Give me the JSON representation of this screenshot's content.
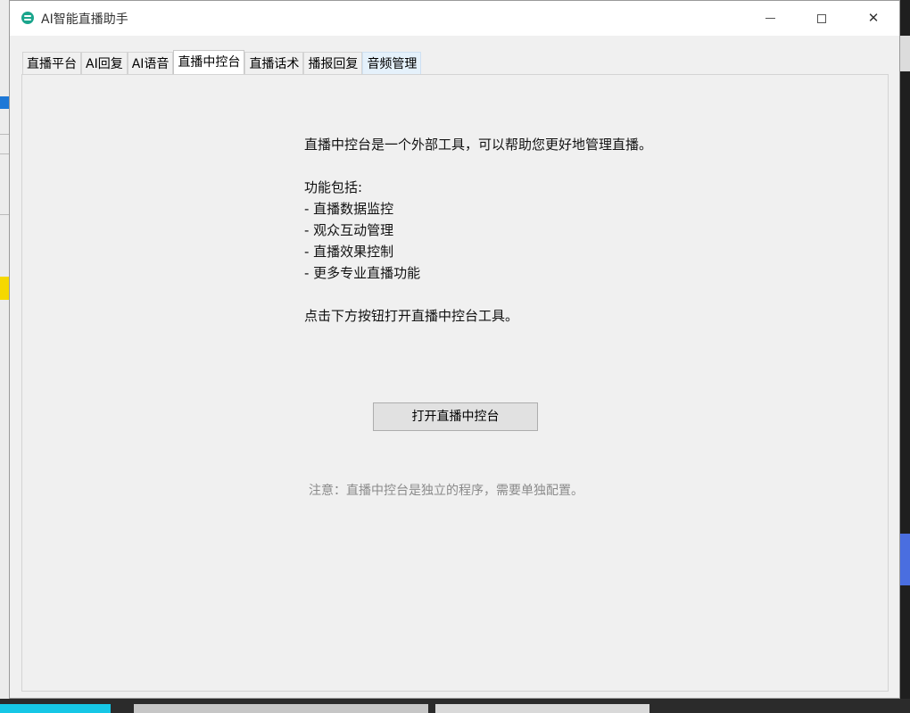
{
  "window": {
    "title": "AI智能直播助手",
    "controls": {
      "minimize": "minimize",
      "maximize": "maximize",
      "close": "✕"
    }
  },
  "tabs": [
    {
      "label": "直播平台"
    },
    {
      "label": "AI回复"
    },
    {
      "label": "AI语音"
    },
    {
      "label": "直播中控台"
    },
    {
      "label": "直播话术"
    },
    {
      "label": "播报回复"
    },
    {
      "label": "音频管理"
    }
  ],
  "active_tab": "直播中控台",
  "panel": {
    "intro": "直播中控台是一个外部工具，可以帮助您更好地管理直播。",
    "features_heading": "功能包括:",
    "features": [
      "- 直播数据监控",
      "- 观众互动管理",
      "- 直播效果控制",
      "- 更多专业直播功能"
    ],
    "instruction": "点击下方按钮打开直播中控台工具。",
    "open_button": "打开直播中控台",
    "note": "注意：直播中控台是独立的程序，需要单独配置。"
  },
  "colors": {
    "app_icon": "#1aa58c",
    "window_bg": "#f0f0f0",
    "hover_tab": "#e5f1fb"
  }
}
